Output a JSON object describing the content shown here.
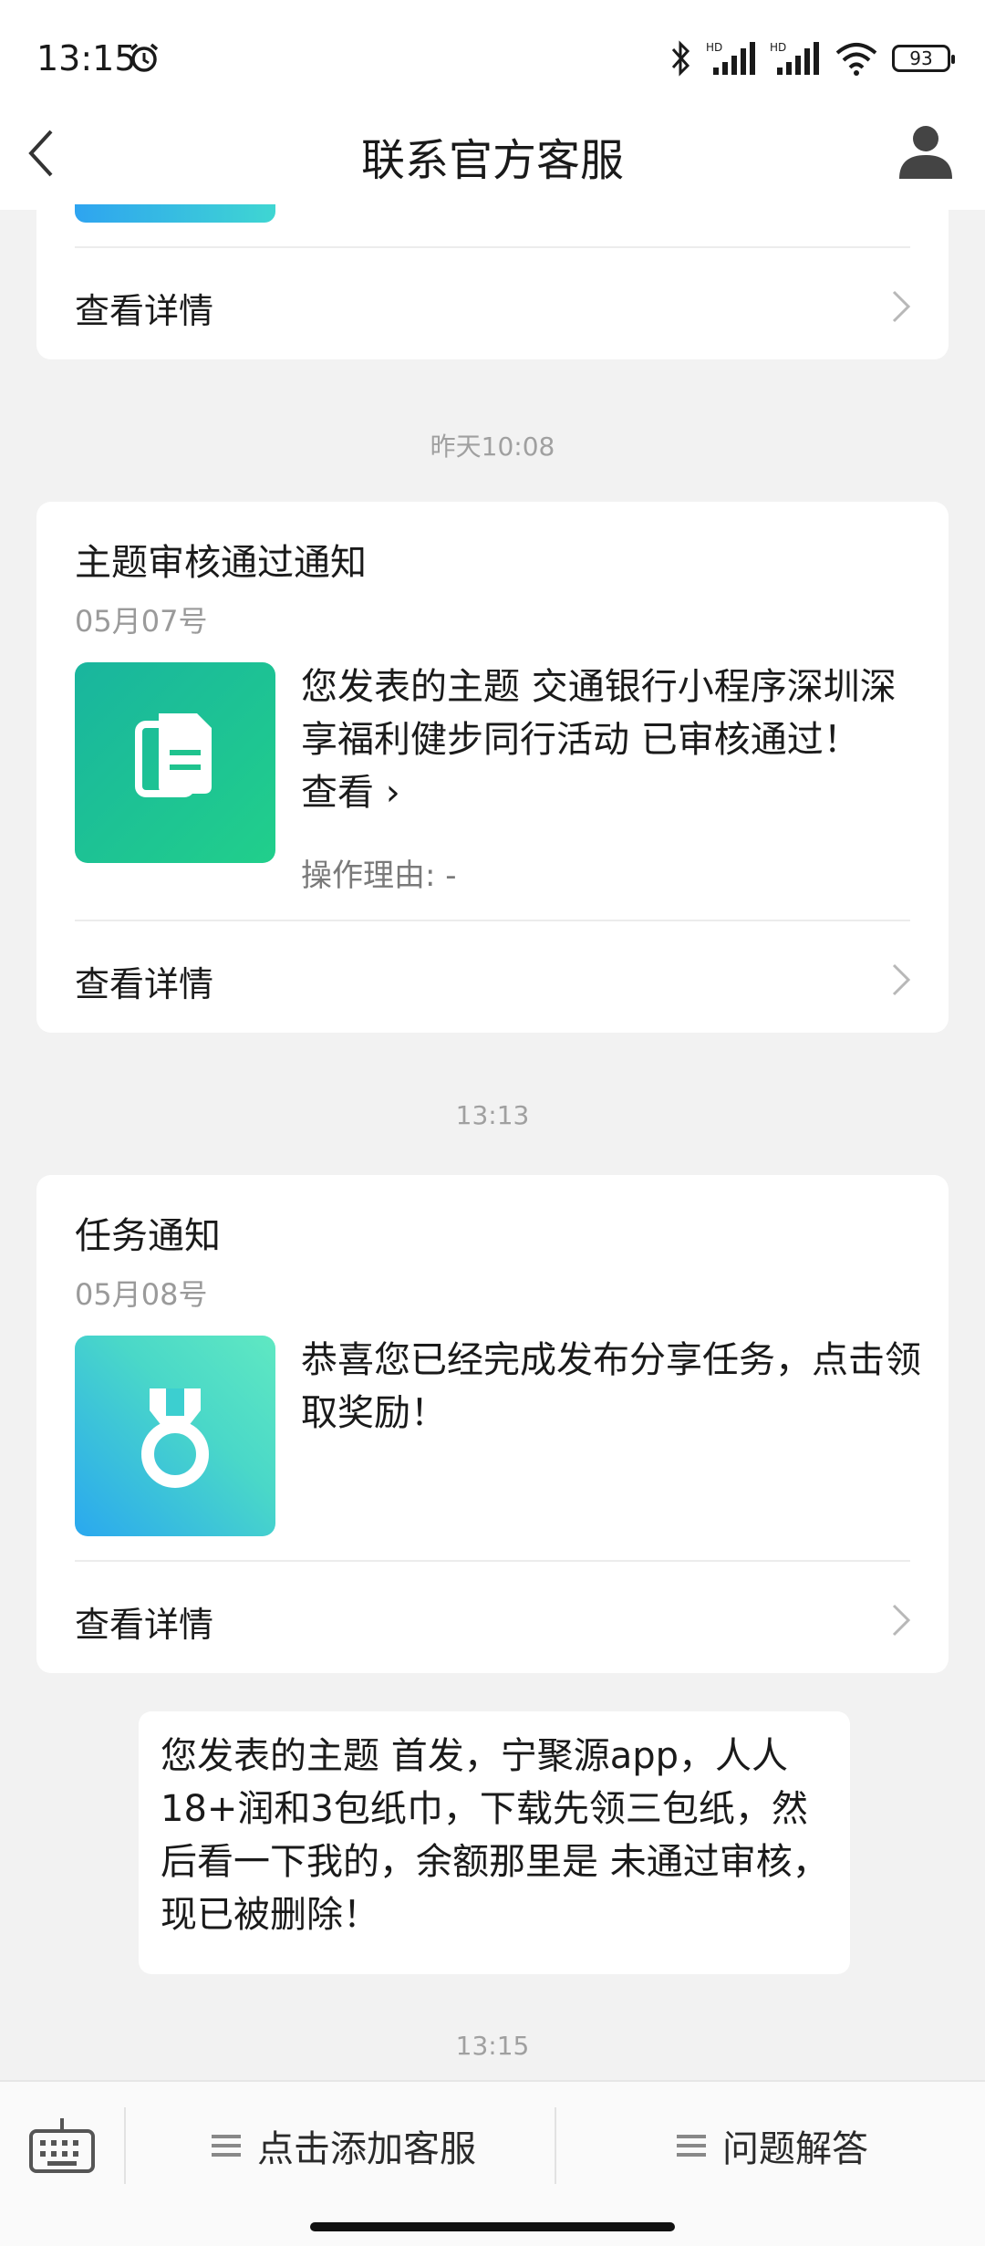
{
  "status_bar": {
    "time": "13:15",
    "battery": "93",
    "network_labels": [
      "HD",
      "HD"
    ]
  },
  "header": {
    "title": "联系官方客服"
  },
  "cards": [
    {
      "detail_label": "查看详情"
    },
    {
      "title": "主题审核通过通知",
      "date": "05月07号",
      "text_main": "您发表的主题 交通银行小程序深圳深享福利健步同行活动 已审核通过！",
      "view_link": "查看 ›",
      "reason": "操作理由: -",
      "detail_label": "查看详情",
      "thumb_icon": "document-icon",
      "thumb_color": "#1fc38e"
    },
    {
      "title": "任务通知",
      "date": "05月08号",
      "text": "恭喜您已经完成发布分享任务，点击领取奖励！",
      "detail_label": "查看详情",
      "thumb_icon": "medal-icon",
      "thumb_color": "#39c9d6"
    }
  ],
  "timestamps": [
    "昨天10:08",
    "13:13",
    "13:15"
  ],
  "bubble": {
    "text": "您发表的主题 首发，宁聚源app，人人18+润和3包纸巾，下载先领三包纸，然后看一下我的，余额那里是 未通过审核，现已被删除！"
  },
  "bottom_bar": {
    "add_service_label": "点击添加客服",
    "faq_label": "问题解答"
  }
}
